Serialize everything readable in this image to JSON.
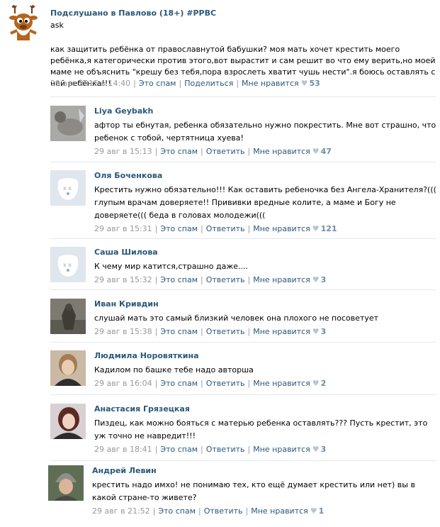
{
  "post": {
    "author": "Подслушано в Павлово (18+) #РРВС",
    "subtitle": "ask",
    "text": "как защитить ребёнка от православнутой бабушки? моя мать хочет крестить моего ребёнка,я категорически против этого,вот вырастит и сам решит во что ему верить,но моей маме не объяснить \"крешу без тебя,пора взрослеть хватит чушь нести\".я боюсь оставлять с ней ребёнка!!!",
    "date": "29 авг 2015 в 14:40",
    "spam": "Это спам",
    "share": "Поделиться",
    "like": "Мне нравится",
    "likes": "53"
  },
  "comments": [
    {
      "author": "Liya Geybakh",
      "text": "афтор ты ебнутая, ребенка обязательно нужно покрестить. Мне вот страшно, что ребенок с тобой, чертятница хуева!",
      "date": "29 авг в 15:13",
      "spam": "Это спам",
      "reply": "Ответить",
      "like": "Мне нравится",
      "likes": "47"
    },
    {
      "author": "Оля Боченкова",
      "text": "Крестить нужно обязательно!!! Как оставить ребеночка без Ангела-Хранителя?((( глупым врачам доверяете!! Прививки вредные колите, а маме и Богу не доверяете((( беда в головах молодежи(((",
      "date": "29 авг в 15:31",
      "spam": "Это спам",
      "reply": "Ответить",
      "like": "Мне нравится",
      "likes": "121"
    },
    {
      "author": "Саша Шилова",
      "text": "К чему мир катится,страшно даже....",
      "date": "29 авг в 15:32",
      "spam": "Это спам",
      "reply": "Ответить",
      "like": "Мне нравится",
      "likes": "3"
    },
    {
      "author": "Иван Кривдин",
      "text": "слушай мать это самый близкий человек она плохого не посоветует",
      "date": "29 авг в 15:38",
      "spam": "Это спам",
      "reply": "Ответить",
      "like": "Мне нравится",
      "likes": "3"
    },
    {
      "author": "Людмила Норовяткина",
      "text": "Кадилом по башке тебе надо авторша",
      "date": "29 авг в 16:04",
      "spam": "Это спам",
      "reply": "Ответить",
      "like": "Мне нравится",
      "likes": "2"
    },
    {
      "author": "Анастасия Грязецкая",
      "text": "Пиздец, как можно бояться с матерью ребенка оставлять??? Пусть крестит, это уж точно не навредит!!!",
      "date": "29 авг в 18:41",
      "spam": "Это спам",
      "reply": "Ответить",
      "like": "Мне нравится",
      "likes": "3"
    },
    {
      "author": "Андрей Левин",
      "text": "крестить надо имхо! не понимаю тех, кто ещё думает крестить или нет) вы в какой стране-то живете?",
      "date": "29 авг в 21:52",
      "spam": "Это спам",
      "reply": "Ответить",
      "like": "Мне нравится",
      "likes": "1"
    }
  ]
}
